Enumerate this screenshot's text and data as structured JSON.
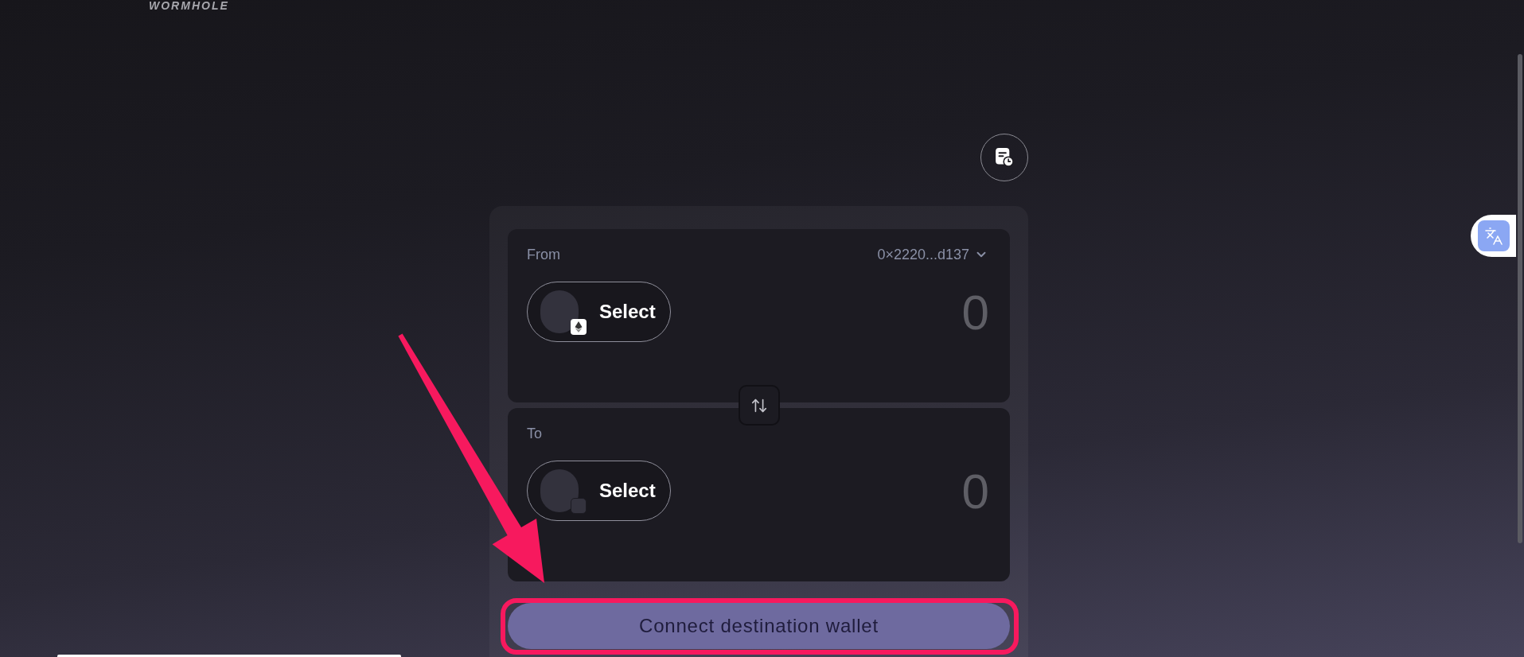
{
  "logo": {
    "text": "WORMHOLE"
  },
  "cards": [
    {
      "label": "From",
      "wallet": "0×2220...d137",
      "token_button": "Select",
      "chain_selected": true,
      "amount": {
        "placeholder": "0"
      }
    },
    {
      "label": "To",
      "token_button": "Select",
      "chain_selected": false,
      "amount": {
        "placeholder": "0"
      }
    }
  ],
  "connect_button": "Connect destination wallet"
}
